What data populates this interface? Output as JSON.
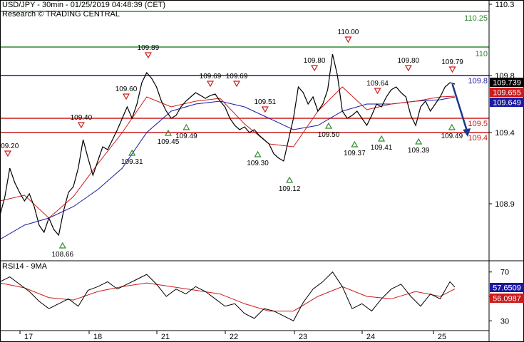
{
  "header": {
    "title": "USD/JPY - 30min - 01/25/2019 04:48:39 (CET)",
    "credit": "Research © TRADING CENTRAL"
  },
  "chart_data": [
    {
      "type": "line",
      "ylim": [
        108.5,
        110.32
      ],
      "grid": false,
      "x_tick_labels": [
        "17",
        "18",
        "21",
        "22",
        "23",
        "24",
        "25"
      ],
      "y_ticks": [
        "110.3",
        "109.8",
        "109.4",
        "108.9"
      ],
      "levels": [
        {
          "value": 110.25,
          "label": "110.25",
          "color": "#2e8b2e"
        },
        {
          "value": 110.0,
          "label": "110",
          "color": "#2e8b2e"
        },
        {
          "value": 109.8,
          "label": "109.8",
          "color": "#1a1aa0"
        },
        {
          "value": 109.5,
          "label": "109.5",
          "color": "#cc1a1a"
        },
        {
          "value": 109.4,
          "label": "109.4",
          "color": "#cc1a1a"
        }
      ],
      "price_tags": [
        {
          "value": 109.739,
          "label": "109.739",
          "bg": "#000000",
          "fg": "#ffffff"
        },
        {
          "value": 109.655,
          "label": "109.655",
          "bg": "#cc1a1a",
          "fg": "#ffffff"
        },
        {
          "value": 109.649,
          "label": "109.649",
          "bg": "#1a1aa0",
          "fg": "#ffffff"
        }
      ],
      "pivots": [
        {
          "label": "109.20",
          "kind": "high",
          "x": 0.016,
          "value": 109.2
        },
        {
          "label": "108.66",
          "kind": "low",
          "x": 0.128,
          "value": 108.66
        },
        {
          "label": "109.40",
          "kind": "high",
          "x": 0.166,
          "value": 109.4
        },
        {
          "label": "109.60",
          "kind": "high",
          "x": 0.258,
          "value": 109.6
        },
        {
          "label": "109.31",
          "kind": "low",
          "x": 0.27,
          "value": 109.31
        },
        {
          "label": "109.89",
          "kind": "high",
          "x": 0.303,
          "value": 109.89
        },
        {
          "label": "109.45",
          "kind": "low",
          "x": 0.344,
          "value": 109.45
        },
        {
          "label": "109.49",
          "kind": "low",
          "x": 0.381,
          "value": 109.49
        },
        {
          "label": "109.69",
          "kind": "high",
          "x": 0.43,
          "value": 109.69
        },
        {
          "label": "109.69",
          "kind": "high",
          "x": 0.484,
          "value": 109.69
        },
        {
          "label": "109.51",
          "kind": "high",
          "x": 0.542,
          "value": 109.51
        },
        {
          "label": "109.30",
          "kind": "low",
          "x": 0.527,
          "value": 109.3
        },
        {
          "label": "109.12",
          "kind": "low",
          "x": 0.592,
          "value": 109.12
        },
        {
          "label": "109.80",
          "kind": "high",
          "x": 0.643,
          "value": 109.8
        },
        {
          "label": "109.50",
          "kind": "low",
          "x": 0.672,
          "value": 109.5
        },
        {
          "label": "110.00",
          "kind": "high",
          "x": 0.712,
          "value": 110.0
        },
        {
          "label": "109.37",
          "kind": "low",
          "x": 0.725,
          "value": 109.37
        },
        {
          "label": "109.64",
          "kind": "high",
          "x": 0.772,
          "value": 109.64
        },
        {
          "label": "109.41",
          "kind": "low",
          "x": 0.78,
          "value": 109.41
        },
        {
          "label": "109.80",
          "kind": "high",
          "x": 0.835,
          "value": 109.8
        },
        {
          "label": "109.39",
          "kind": "low",
          "x": 0.856,
          "value": 109.39
        },
        {
          "label": "109.79",
          "kind": "high",
          "x": 0.925,
          "value": 109.79
        },
        {
          "label": "109.49",
          "kind": "low",
          "x": 0.924,
          "value": 109.49
        }
      ],
      "series": [
        {
          "color": "#000000",
          "x": [
            0,
            0.01,
            0.02,
            0.03,
            0.04,
            0.05,
            0.06,
            0.07,
            0.08,
            0.09,
            0.1,
            0.11,
            0.12,
            0.13,
            0.14,
            0.15,
            0.16,
            0.17,
            0.18,
            0.19,
            0.2,
            0.21,
            0.22,
            0.23,
            0.24,
            0.25,
            0.26,
            0.27,
            0.28,
            0.29,
            0.3,
            0.31,
            0.32,
            0.33,
            0.34,
            0.35,
            0.36,
            0.37,
            0.38,
            0.39,
            0.4,
            0.41,
            0.42,
            0.43,
            0.44,
            0.45,
            0.46,
            0.47,
            0.48,
            0.49,
            0.5,
            0.51,
            0.52,
            0.53,
            0.54,
            0.55,
            0.56,
            0.57,
            0.58,
            0.59,
            0.6,
            0.61,
            0.62,
            0.63,
            0.64,
            0.65,
            0.66,
            0.67,
            0.68,
            0.69,
            0.7,
            0.71,
            0.72,
            0.73,
            0.74,
            0.75,
            0.76,
            0.77,
            0.78,
            0.79,
            0.8,
            0.81,
            0.82,
            0.83,
            0.84,
            0.85,
            0.86,
            0.87,
            0.88,
            0.89,
            0.9,
            0.91,
            0.92,
            0.93
          ],
          "values": [
            108.82,
            108.95,
            109.15,
            109.05,
            108.98,
            108.92,
            108.97,
            108.88,
            108.75,
            108.7,
            108.8,
            108.72,
            108.68,
            108.85,
            108.98,
            109.02,
            109.15,
            109.35,
            109.22,
            109.1,
            109.2,
            109.3,
            109.28,
            109.35,
            109.42,
            109.5,
            109.58,
            109.5,
            109.6,
            109.75,
            109.82,
            109.78,
            109.72,
            109.62,
            109.55,
            109.5,
            109.52,
            109.58,
            109.62,
            109.65,
            109.68,
            109.66,
            109.64,
            109.66,
            109.67,
            109.62,
            109.58,
            109.5,
            109.45,
            109.42,
            109.44,
            109.4,
            109.42,
            109.38,
            109.35,
            109.32,
            109.25,
            109.22,
            109.2,
            109.35,
            109.5,
            109.72,
            109.68,
            109.6,
            109.65,
            109.55,
            109.6,
            109.7,
            109.95,
            109.8,
            109.55,
            109.5,
            109.52,
            109.55,
            109.5,
            109.45,
            109.52,
            109.6,
            109.58,
            109.65,
            109.7,
            109.72,
            109.68,
            109.65,
            109.52,
            109.45,
            109.58,
            109.62,
            109.55,
            109.6,
            109.65,
            109.72,
            109.75,
            109.74
          ]
        },
        {
          "color": "#cc1a1a",
          "x": [
            0,
            0.05,
            0.1,
            0.15,
            0.2,
            0.25,
            0.3,
            0.35,
            0.4,
            0.45,
            0.5,
            0.55,
            0.6,
            0.65,
            0.7,
            0.75,
            0.8,
            0.85,
            0.9,
            0.93
          ],
          "values": [
            108.92,
            108.96,
            108.8,
            108.95,
            109.18,
            109.4,
            109.65,
            109.58,
            109.62,
            109.64,
            109.46,
            109.32,
            109.3,
            109.55,
            109.72,
            109.56,
            109.6,
            109.62,
            109.65,
            109.655
          ]
        },
        {
          "color": "#1a1aa0",
          "x": [
            0,
            0.05,
            0.1,
            0.15,
            0.2,
            0.25,
            0.3,
            0.35,
            0.4,
            0.45,
            0.5,
            0.55,
            0.6,
            0.65,
            0.7,
            0.75,
            0.8,
            0.85,
            0.9,
            0.93
          ],
          "values": [
            108.65,
            108.75,
            108.8,
            108.88,
            109.0,
            109.15,
            109.4,
            109.55,
            109.6,
            109.62,
            109.58,
            109.5,
            109.42,
            109.45,
            109.55,
            109.6,
            109.6,
            109.62,
            109.63,
            109.649
          ]
        }
      ],
      "forecast": [
        {
          "x": 0.925,
          "value": 109.74
        },
        {
          "x": 0.955,
          "value": 109.38
        }
      ]
    },
    {
      "type": "line",
      "title": "RSI14 - 9MA",
      "ylim": [
        22,
        78
      ],
      "y_ticks": [
        "70",
        "50",
        "30"
      ],
      "price_tags": [
        {
          "value": 57.6509,
          "label": "57.6509",
          "bg": "#1a1aa0",
          "fg": "#ffffff"
        },
        {
          "value": 50.0,
          "label": "56.0987",
          "bg": "#cc1a1a",
          "fg": "#ffffff"
        }
      ],
      "series": [
        {
          "color": "#000000",
          "x": [
            0,
            0.02,
            0.04,
            0.06,
            0.08,
            0.1,
            0.12,
            0.14,
            0.16,
            0.18,
            0.2,
            0.22,
            0.24,
            0.26,
            0.28,
            0.3,
            0.32,
            0.34,
            0.36,
            0.38,
            0.4,
            0.42,
            0.44,
            0.46,
            0.48,
            0.5,
            0.52,
            0.54,
            0.56,
            0.58,
            0.6,
            0.62,
            0.64,
            0.66,
            0.68,
            0.7,
            0.72,
            0.74,
            0.76,
            0.78,
            0.8,
            0.82,
            0.84,
            0.86,
            0.88,
            0.9,
            0.92,
            0.93
          ],
          "values": [
            62,
            66,
            60,
            54,
            46,
            40,
            44,
            48,
            42,
            55,
            58,
            62,
            56,
            60,
            64,
            68,
            60,
            50,
            56,
            52,
            58,
            54,
            48,
            42,
            44,
            36,
            32,
            40,
            38,
            34,
            30,
            45,
            56,
            62,
            70,
            58,
            40,
            44,
            38,
            48,
            56,
            60,
            50,
            42,
            52,
            48,
            62,
            57.6
          ]
        },
        {
          "color": "#cc1a1a",
          "x": [
            0,
            0.05,
            0.1,
            0.15,
            0.2,
            0.25,
            0.3,
            0.35,
            0.4,
            0.45,
            0.5,
            0.55,
            0.6,
            0.65,
            0.7,
            0.75,
            0.8,
            0.85,
            0.9,
            0.93
          ],
          "values": [
            61,
            57,
            49,
            47,
            54,
            58,
            61,
            58,
            55,
            52,
            44,
            38,
            38,
            50,
            58,
            50,
            48,
            54,
            50,
            56.1
          ]
        }
      ]
    }
  ]
}
